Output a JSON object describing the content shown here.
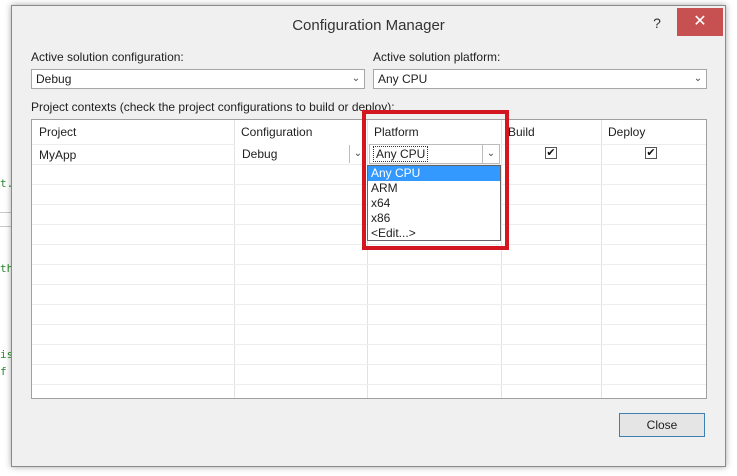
{
  "window": {
    "title": "Configuration Manager",
    "help_glyph": "?",
    "close_glyph": "✕"
  },
  "background_code": {
    "line1": "t.",
    "line2": "th",
    "line3": "is",
    "line4": "f"
  },
  "active_config": {
    "label": "Active solution configuration:",
    "value": "Debug"
  },
  "active_platform": {
    "label": "Active solution platform:",
    "value": "Any CPU"
  },
  "project_contexts_label": "Project contexts (check the project configurations to build or deploy):",
  "grid": {
    "headers": {
      "project": "Project",
      "configuration": "Configuration",
      "platform": "Platform",
      "build": "Build",
      "deploy": "Deploy"
    },
    "rows": [
      {
        "project": "MyApp",
        "configuration": "Debug",
        "platform": "Any CPU",
        "build_checked": true,
        "deploy_checked": true
      }
    ]
  },
  "platform_dropdown": {
    "options": [
      "Any CPU",
      "ARM",
      "x64",
      "x86",
      "<Edit...>"
    ],
    "selected": "Any CPU"
  },
  "glyphs": {
    "check": "✔",
    "chevron": "⌄"
  },
  "close_button": "Close",
  "colors": {
    "highlight_border": "#d4161e",
    "selection": "#3399ff",
    "title_close_bg": "#c75050"
  }
}
